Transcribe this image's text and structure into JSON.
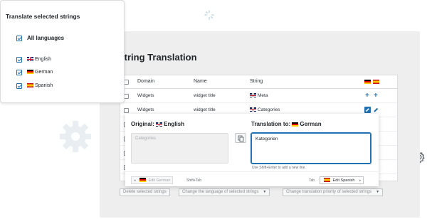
{
  "languages_card": {
    "title": "Translate selected strings",
    "all_label": "All languages",
    "languages": [
      {
        "code": "gb",
        "name": "English"
      },
      {
        "code": "de",
        "name": "German"
      },
      {
        "code": "es",
        "name": "Spanish"
      }
    ]
  },
  "panel": {
    "title": "String Translation"
  },
  "table": {
    "headers": {
      "domain": "Domain",
      "name": "Name",
      "string": "String"
    },
    "header_flags": [
      "de",
      "es"
    ],
    "rows": [
      {
        "domain": "Widgets",
        "name": "widget title",
        "string": "Meta",
        "flag": "gb",
        "actions": "add"
      },
      {
        "domain": "Widgets",
        "name": "widget title",
        "string": "Categories",
        "flag": "gb",
        "actions": "edit"
      }
    ]
  },
  "popup": {
    "original_label": "Original:",
    "original_language": "English",
    "translation_label": "Translation to:",
    "translation_language": "German",
    "original_text": "Categories",
    "translation_value": "Kategorien",
    "hint": "Use Shift+Enter to add a new line.",
    "prev_button": "Edit German",
    "prev_shortcut": "Shift+Tab",
    "next_shortcut": "Tab",
    "next_button": "Edit Spanish"
  },
  "bulk_actions": {
    "delete": "Delete selected strings",
    "change_language": "Change the language of selected strings",
    "change_priority": "Change translation priority of selected strings"
  },
  "colors": {
    "accent": "#2271b1",
    "panel_bg": "#eeeeee"
  }
}
